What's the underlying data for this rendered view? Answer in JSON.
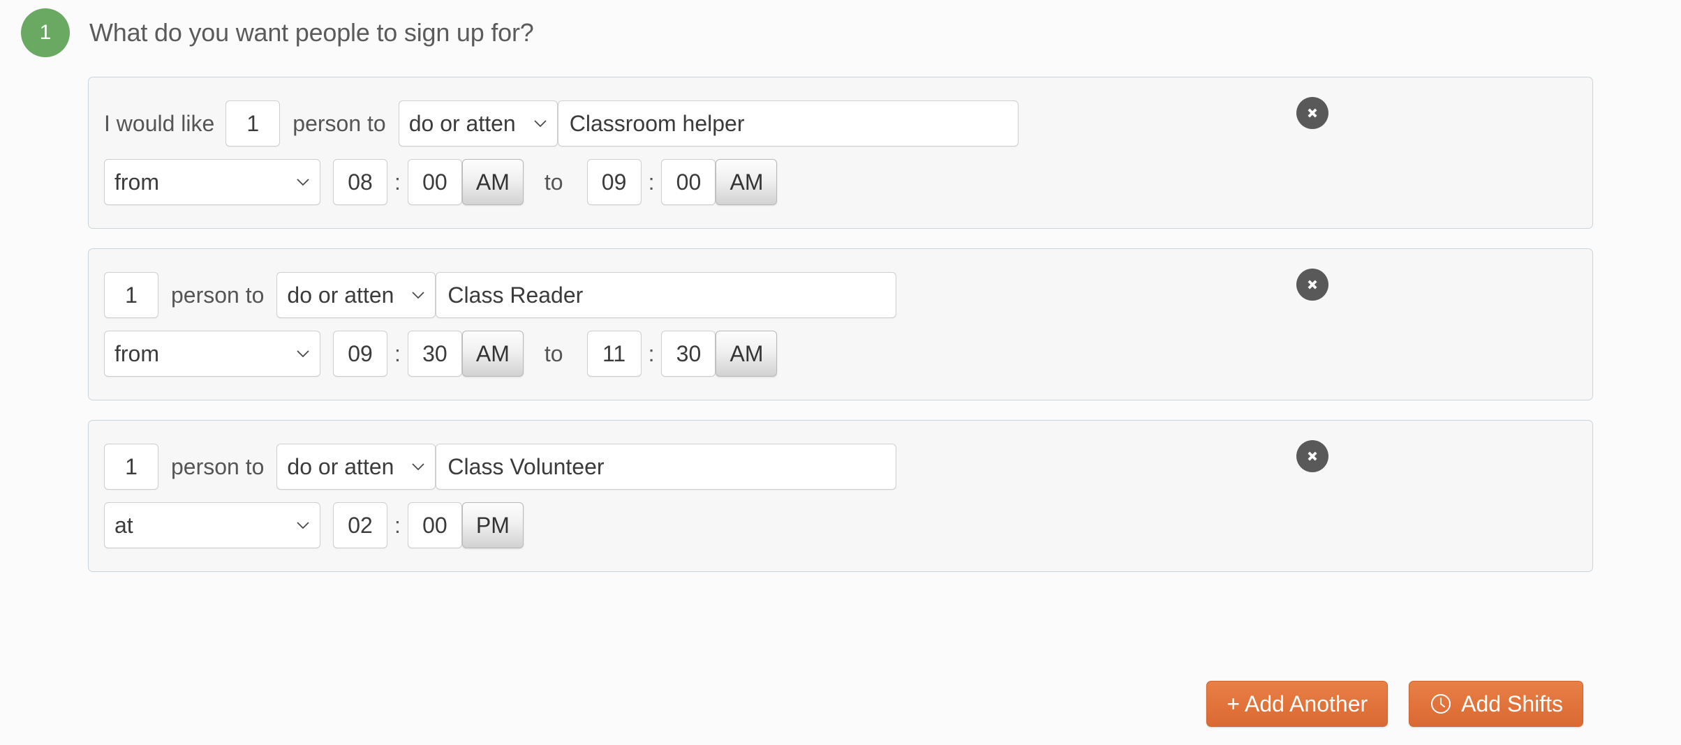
{
  "header": {
    "step_number": "1",
    "title": "What do you want people to sign up for?",
    "badge_color": "#6aa961"
  },
  "labels": {
    "lead_in": "I would like",
    "person_to": "person to",
    "to": "to",
    "colon": ":"
  },
  "slots": [
    {
      "show_lead_in": true,
      "quantity": "1",
      "person_label": "person to",
      "activity_type": "do or atten",
      "activity_name": "Classroom helper",
      "time_mode": "from",
      "start_hour": "08",
      "start_minute": "00",
      "start_period": "AM",
      "has_end_time": true,
      "to_label": "to",
      "end_hour": "09",
      "end_minute": "00",
      "end_period": "AM",
      "delete_icon": "close-circle-icon"
    },
    {
      "show_lead_in": false,
      "quantity": "1",
      "person_label": "person to",
      "activity_type": "do or atten",
      "activity_name": "Class Reader",
      "time_mode": "from",
      "start_hour": "09",
      "start_minute": "30",
      "start_period": "AM",
      "has_end_time": true,
      "to_label": "to",
      "end_hour": "11",
      "end_minute": "30",
      "end_period": "AM",
      "delete_icon": "close-circle-icon"
    },
    {
      "show_lead_in": false,
      "quantity": "1",
      "person_label": "person to",
      "activity_type": "do or atten",
      "activity_name": "Class Volunteer",
      "time_mode": "at",
      "start_hour": "02",
      "start_minute": "00",
      "start_period": "PM",
      "has_end_time": false,
      "to_label": "to",
      "end_hour": "",
      "end_minute": "",
      "end_period": "",
      "delete_icon": "close-circle-icon"
    }
  ],
  "footer": {
    "add_another_label": "+ Add Another",
    "add_shifts_label": "Add Shifts",
    "add_shifts_icon": "clock-icon",
    "button_color": "#e0723a"
  }
}
